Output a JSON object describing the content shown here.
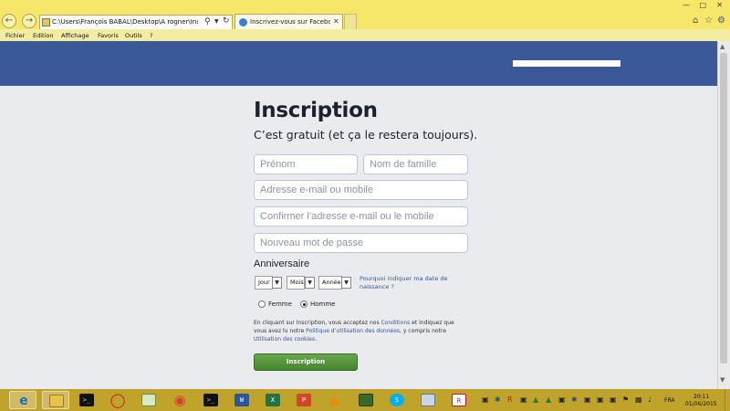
{
  "browser": {
    "address": "C:\\Users\\François BABAL\\Desktop\\A rogner\\Inscrivez",
    "tab_title": "Inscrivez-vous sur Faceboo...",
    "menu": [
      "Fichier",
      "Edition",
      "Affichage",
      "Favoris",
      "Outils",
      "?"
    ]
  },
  "form": {
    "title": "Inscription",
    "subtitle": "C’est gratuit (et ça le restera toujours).",
    "firstname_placeholder": "Prénom",
    "lastname_placeholder": "Nom de famille",
    "email_placeholder": "Adresse e-mail ou mobile",
    "email_confirm_placeholder": "Confirmer l’adresse e-mail ou le mobile",
    "password_placeholder": "Nouveau mot de passe",
    "birthday": {
      "label": "Anniversaire",
      "day": "Jour",
      "month": "Mois",
      "year": "Année",
      "why": "Pourquoi indiquer ma date de naissance ?"
    },
    "gender": {
      "female": "Femme",
      "male": "Homme",
      "selected": "male"
    },
    "terms": {
      "part1": "En cliquant sur Inscription, vous acceptez nos ",
      "link_conditions": "Conditions",
      "part2": " et indiquez que vous avez lu notre ",
      "link_policy": "Politique d’utilisation des données",
      "part3": ", y compris notre ",
      "link_cookies": "Utilisation des cookies",
      "part4": "."
    },
    "submit": "Inscription"
  },
  "taskbar": {
    "apps": [
      {
        "icon": "internet-explorer-icon",
        "active": true
      },
      {
        "icon": "file-explorer-icon",
        "active": true
      },
      {
        "icon": "command-prompt-icon",
        "active": false
      },
      {
        "icon": "opera-icon",
        "active": false
      },
      {
        "icon": "image-viewer-icon",
        "active": false
      },
      {
        "icon": "chrome-icon",
        "active": false
      },
      {
        "icon": "command-prompt-icon",
        "active": false
      },
      {
        "icon": "word-icon",
        "active": false
      },
      {
        "icon": "excel-icon",
        "active": false
      },
      {
        "icon": "powerpoint-icon",
        "active": false
      },
      {
        "icon": "vlc-icon",
        "active": false
      },
      {
        "icon": "books-icon",
        "active": false
      },
      {
        "icon": "skype-icon",
        "active": false
      },
      {
        "icon": "calculator-icon",
        "active": false
      },
      {
        "icon": "r-app-icon",
        "active": false
      }
    ],
    "lang": "FRA",
    "time": "20:11",
    "date": "01/06/2015"
  },
  "colors": {
    "facebook_blue": "#3b5998",
    "chrome_yellow": "#f6e76a",
    "taskbar": "#bfa32a",
    "button_green": "#4b8f2f",
    "link_blue": "#365899"
  }
}
